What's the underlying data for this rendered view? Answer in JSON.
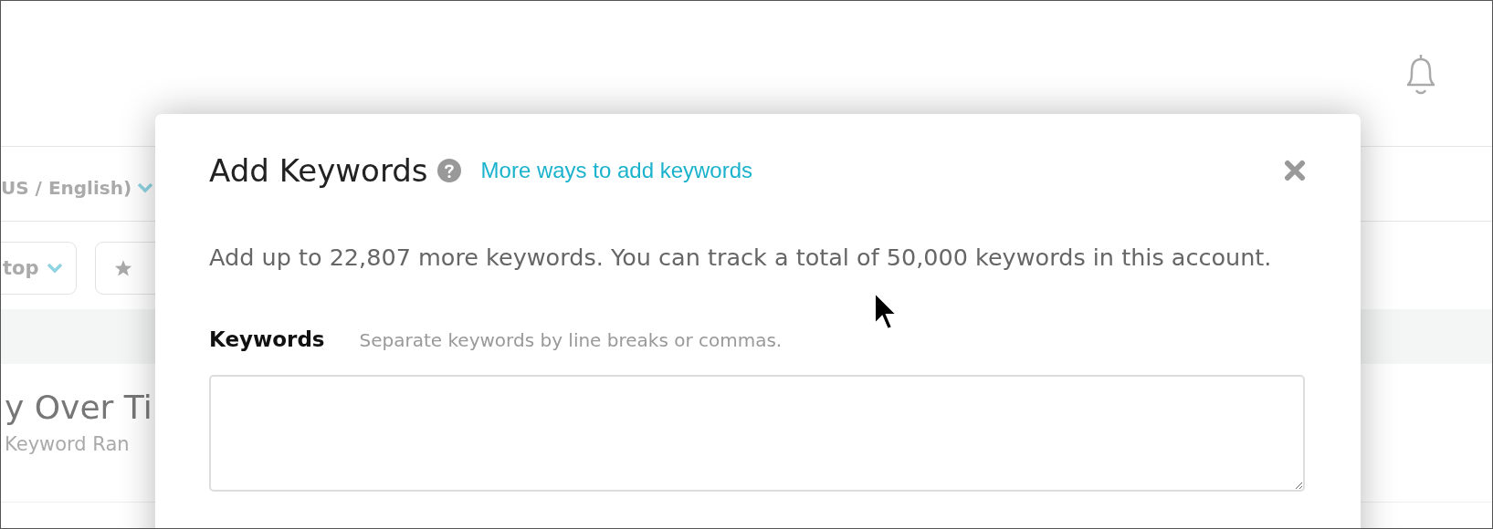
{
  "background": {
    "locale": "US / English)",
    "device_filter": "top",
    "title": "y Over Ti",
    "subtitle": "Keyword Ran"
  },
  "dialog": {
    "title": "Add Keywords",
    "link": "More ways to add keywords",
    "description": "Add up to 22,807 more keywords. You can track a total of 50,000 keywords in this account.",
    "field": {
      "label": "Keywords",
      "hint": "Separate keywords by line breaks or commas."
    }
  }
}
